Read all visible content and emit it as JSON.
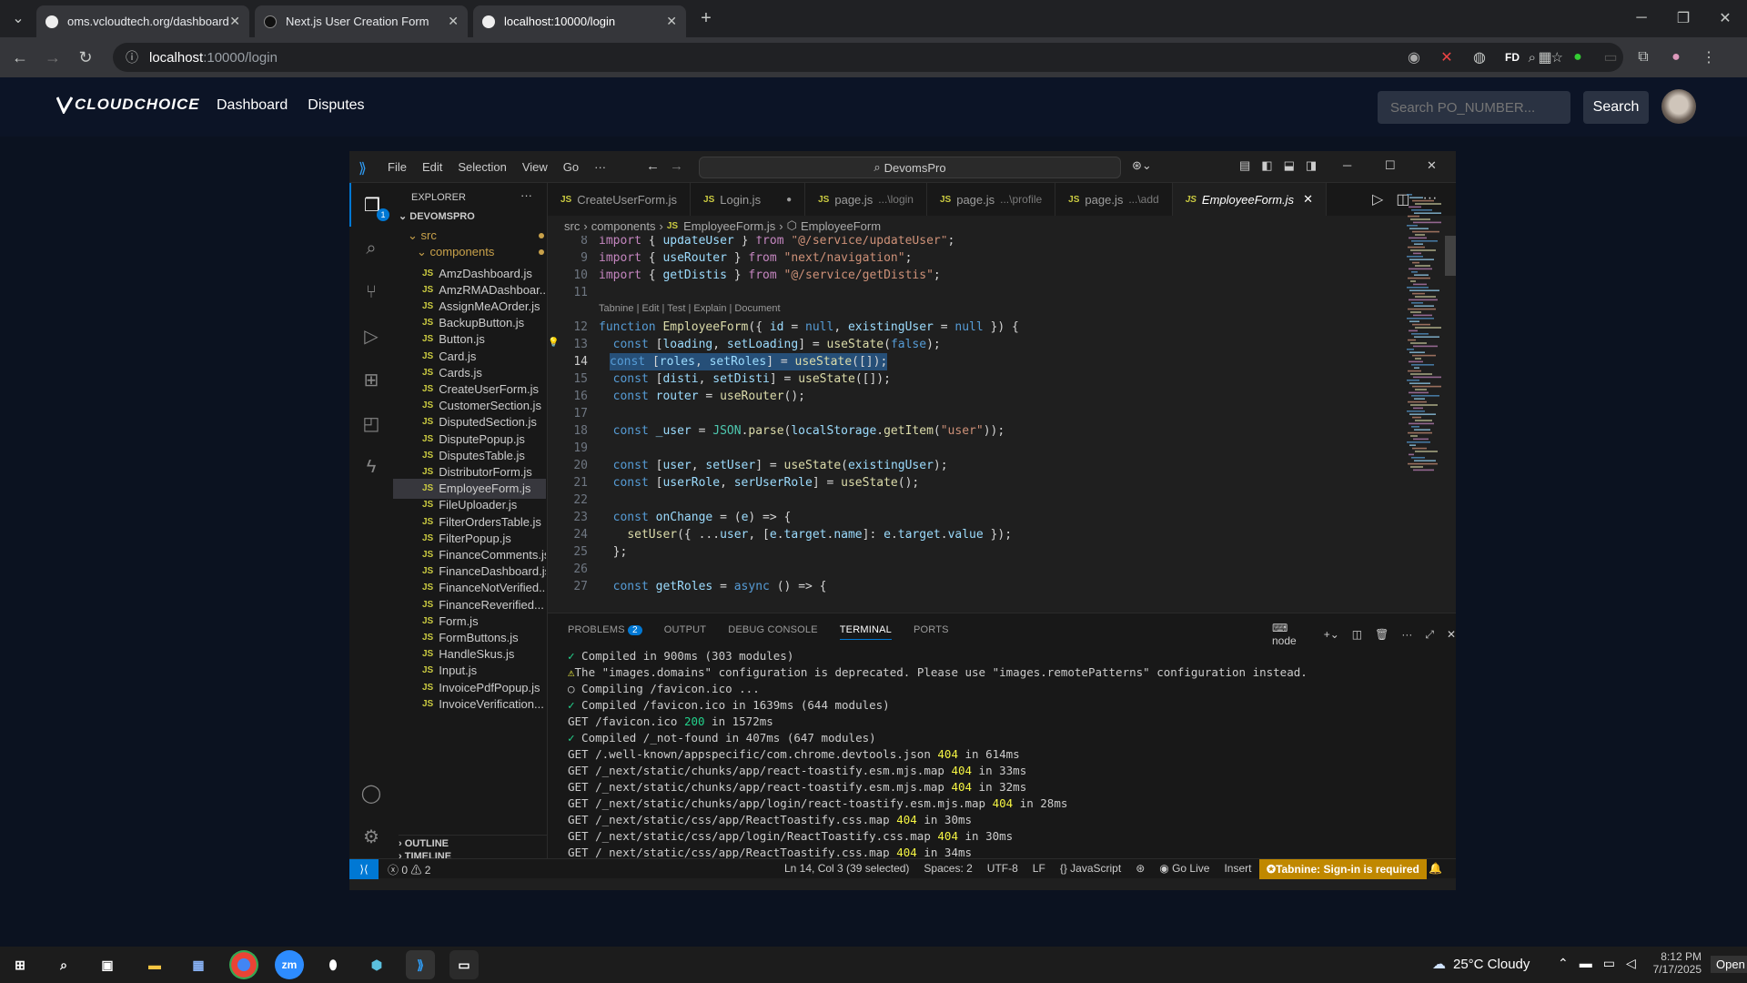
{
  "browser": {
    "tabs": [
      {
        "title": "oms.vcloudtech.org/dashboard"
      },
      {
        "title": "Next.js User Creation Form"
      },
      {
        "title": "localhost:10000/login"
      }
    ],
    "url_host": "localhost",
    "url_rest": ":10000/login"
  },
  "site": {
    "logo": "CLOUDCHOICE",
    "nav": [
      "Dashboard",
      "Disputes"
    ],
    "search_placeholder": "Search PO_NUMBER...",
    "search_button": "Search"
  },
  "vscode": {
    "menu": [
      "File",
      "Edit",
      "Selection",
      "View",
      "Go",
      "···"
    ],
    "command_center": "DevomsPro",
    "explorer_title": "EXPLORER",
    "workspace": "DEVOMSPRO",
    "src": "src",
    "components": "components",
    "files": [
      "AmzDashboard.js",
      "AmzRMADashboar...",
      "AssignMeAOrder.js",
      "BackupButton.js",
      "Button.js",
      "Card.js",
      "Cards.js",
      "CreateUserForm.js",
      "CustomerSection.js",
      "DisputedSection.js",
      "DisputePopup.js",
      "DisputesTable.js",
      "DistributorForm.js",
      "EmployeeForm.js",
      "FileUploader.js",
      "FilterOrdersTable.js",
      "FilterPopup.js",
      "FinanceComments.js",
      "FinanceDashboard.js",
      "FinanceNotVerified...",
      "FinanceReverified...",
      "Form.js",
      "FormButtons.js",
      "HandleSkus.js",
      "Input.js",
      "InvoicePdfPopup.js",
      "InvoiceVerification..."
    ],
    "outline": "OUTLINE",
    "timeline": "TIMELINE",
    "editor_tabs": [
      {
        "name": "CreateUserForm.js",
        "hint": ""
      },
      {
        "name": "Login.js",
        "hint": ""
      },
      {
        "name": "page.js",
        "hint": "...\\login"
      },
      {
        "name": "page.js",
        "hint": "...\\profile"
      },
      {
        "name": "page.js",
        "hint": "...\\add"
      },
      {
        "name": "EmployeeForm.js",
        "hint": ""
      }
    ],
    "breadcrumb": [
      "src",
      "components",
      "EmployeeForm.js",
      "EmployeeForm"
    ],
    "codelens": "Tabnine | Edit | Test | Explain | Document",
    "line_numbers": [
      "8",
      "9",
      "10",
      "11",
      "12",
      "13",
      "14",
      "15",
      "16",
      "17",
      "18",
      "19",
      "20",
      "21",
      "22",
      "23",
      "24",
      "25",
      "26",
      "27"
    ],
    "code_lines": [
      "import { updateUser } from \"@/service/updateUser\";",
      "import { useRouter } from \"next/navigation\";",
      "import { getDistis } from \"@/service/getDistis\";",
      "",
      "function EmployeeForm({ id = null, existingUser = null }) {",
      "  const [loading, setLoading] = useState(false);",
      "  const [roles, setRoles] = useState([]);",
      "  const [disti, setDisti] = useState([]);",
      "  const router = useRouter();",
      "",
      "  const _user = JSON.parse(localStorage.getItem(\"user\"));",
      "",
      "  const [user, setUser] = useState(existingUser);",
      "  const [userRole, serUserRole] = useState();",
      "",
      "  const onChange = (e) => {",
      "    setUser({ ...user, [e.target.name]: e.target.value });",
      "  };",
      "",
      "  const getRoles = async () => {"
    ],
    "panel_tabs": [
      "PROBLEMS",
      "OUTPUT",
      "DEBUG CONSOLE",
      "TERMINAL",
      "PORTS"
    ],
    "problems_count": "2",
    "terminal_shell": "node",
    "terminal_lines": [
      {
        "mark": "✓",
        "text": " Compiled in 900ms (303 modules)"
      },
      {
        "mark": "⚠",
        "text": "The \"images.domains\" configuration is deprecated. Please use \"images.remotePatterns\" configuration instead."
      },
      {
        "mark": "○",
        "text": " Compiling /favicon.ico ..."
      },
      {
        "mark": "✓",
        "text": " Compiled /favicon.ico in 1639ms (644 modules)"
      },
      {
        "mark": "",
        "text": "GET /favicon.ico ",
        "code": "200",
        "tail": " in 1572ms"
      },
      {
        "mark": "✓",
        "text": " Compiled /_not-found in 407ms (647 modules)"
      },
      {
        "mark": "",
        "text": "GET /.well-known/appspecific/com.chrome.devtools.json ",
        "code": "404",
        "tail": " in 614ms"
      },
      {
        "mark": "",
        "text": "GET /_next/static/chunks/app/react-toastify.esm.mjs.map ",
        "code": "404",
        "tail": " in 33ms"
      },
      {
        "mark": "",
        "text": "GET /_next/static/chunks/app/react-toastify.esm.mjs.map ",
        "code": "404",
        "tail": " in 32ms"
      },
      {
        "mark": "",
        "text": "GET /_next/static/chunks/app/login/react-toastify.esm.mjs.map ",
        "code": "404",
        "tail": " in 28ms"
      },
      {
        "mark": "",
        "text": "GET /_next/static/css/app/ReactToastify.css.map ",
        "code": "404",
        "tail": " in 30ms"
      },
      {
        "mark": "",
        "text": "GET /_next/static/css/app/login/ReactToastify.css.map ",
        "code": "404",
        "tail": " in 30ms"
      },
      {
        "mark": "",
        "text": "GET /_next/static/css/app/ReactToastify.css.map ",
        "code": "404",
        "tail": " in 34ms"
      }
    ],
    "status": {
      "errors": "0",
      "warnings": "2",
      "position": "Ln 14, Col 3 (39 selected)",
      "spaces": "Spaces: 2",
      "encoding": "UTF-8",
      "eol": "LF",
      "language": "JavaScript",
      "golive": "Go Live",
      "mode": "Insert",
      "tabnine": "Tabnine: Sign-in is required"
    }
  },
  "taskbar": {
    "weather": "25°C  Cloudy",
    "time": "8:12 PM",
    "date": "7/17/2025",
    "open": "Open"
  },
  "colors": {
    "accent": "#0078d4",
    "site_bg": "#0c1426",
    "tabnine": "#c08800"
  }
}
